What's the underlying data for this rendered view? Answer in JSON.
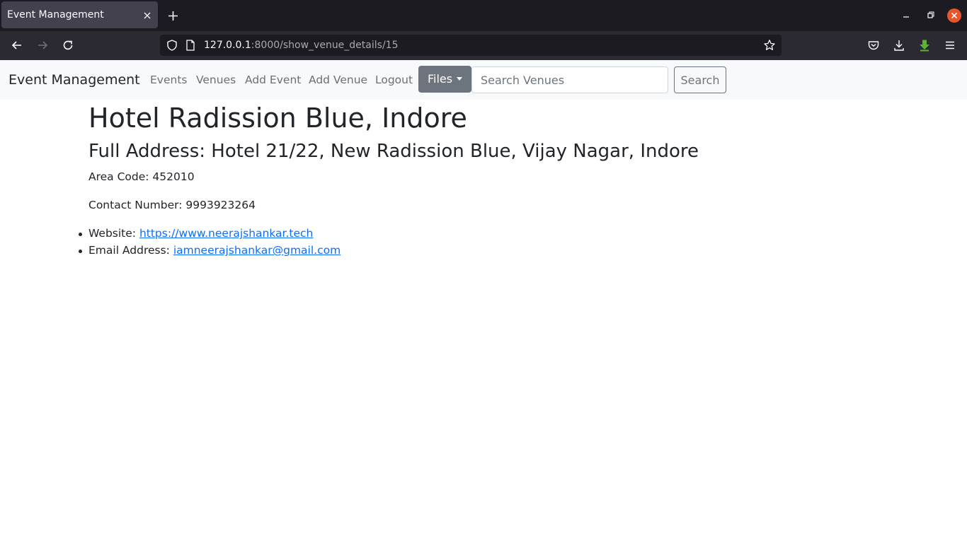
{
  "browser": {
    "tab_title": "Event Management",
    "url_host": "127.0.0.1",
    "url_rest": ":8000/show_venue_details/15"
  },
  "site_nav": {
    "brand": "Event Management",
    "links": [
      "Events",
      "Venues",
      "Add Event",
      "Add Venue",
      "Logout"
    ],
    "files_label": "Files",
    "search_placeholder": "Search Venues",
    "search_button": "Search"
  },
  "venue": {
    "name": "Hotel Radission Blue, Indore",
    "address_line": "Full Address: Hotel 21/22, New Radission Blue, Vijay Nagar, Indore",
    "area_code_line": "Area Code: 452010",
    "contact_line": "Contact Number: 9993923264",
    "website_label": "Website:",
    "website_url": "https://www.neerajshankar.tech",
    "email_label": "Email Address:",
    "email": "iamneerajshankar@gmail.com"
  },
  "colors": {
    "link": "#0d6efd",
    "files_button_bg": "#6c757d",
    "window_close": "#e9542a",
    "download_arrow": "#5cb531"
  },
  "icons": {
    "back": "arrow-left-icon",
    "forward": "arrow-right-icon",
    "reload": "reload-icon",
    "shield": "tracking-protection-icon",
    "page": "page-icon",
    "bookmark": "star-icon",
    "pocket": "pocket-icon",
    "downloads": "download-icon",
    "extension": "green-download-icon",
    "menu": "hamburger-menu-icon"
  }
}
